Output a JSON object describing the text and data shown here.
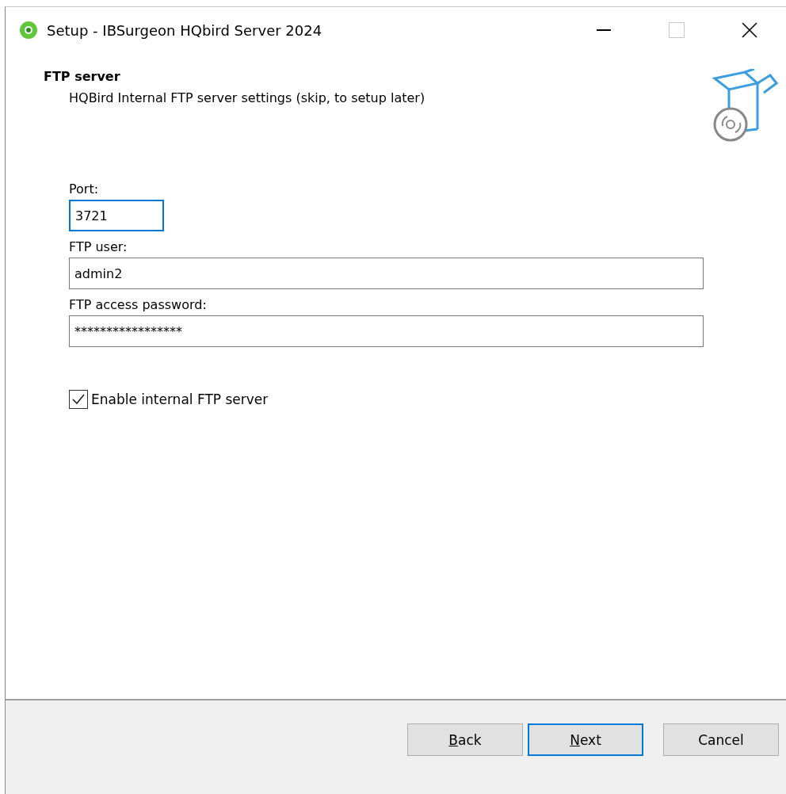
{
  "window": {
    "title": "Setup - IBSurgeon HQbird Server 2024"
  },
  "header": {
    "title": "FTP server",
    "subtitle": "HQBird Internal FTP server settings (skip, to setup later)"
  },
  "fields": [
    {
      "label": "Port:",
      "value": "3721",
      "focused": true,
      "kind": "short"
    },
    {
      "label": "FTP user:",
      "value": "admin2",
      "focused": false,
      "kind": "wide"
    },
    {
      "label": "FTP access password:",
      "value": "*****************",
      "focused": false,
      "kind": "wide"
    }
  ],
  "checkbox": {
    "label": "Enable internal FTP server",
    "checked": true
  },
  "buttons": [
    {
      "key": "B",
      "rest": "ack",
      "default": false
    },
    {
      "key": "N",
      "rest": "ext",
      "default": true
    },
    {
      "rest": "Cancel",
      "default": false
    }
  ]
}
